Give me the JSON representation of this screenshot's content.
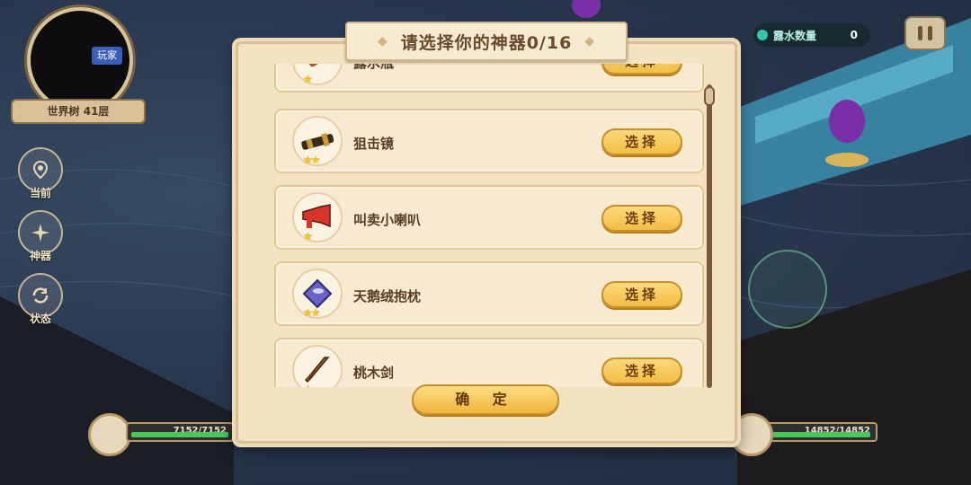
{
  "modal": {
    "title": "请选择你的神器0/16",
    "confirm_label": "确 定",
    "items": [
      {
        "name": "露水瓶",
        "stars": "★",
        "button": "选择",
        "icon": "bottle-icon"
      },
      {
        "name": "狙击镜",
        "stars": "★★",
        "button": "选择",
        "icon": "scope-icon"
      },
      {
        "name": "叫卖小喇叭",
        "stars": "★",
        "button": "选择",
        "icon": "megaphone-icon"
      },
      {
        "name": "天鹅绒抱枕",
        "stars": "★★",
        "button": "选择",
        "icon": "pillow-icon"
      },
      {
        "name": "桃木剑",
        "stars": "★",
        "button": "选择",
        "icon": "wooden-sword-icon"
      }
    ]
  },
  "minimap": {
    "player_label": "玩家",
    "floor": "世界树 41层"
  },
  "side_menu": [
    {
      "label": "当前",
      "icon": "location-pin-icon"
    },
    {
      "label": "神器",
      "icon": "compass-star-icon"
    },
    {
      "label": "状态",
      "icon": "cycle-icon"
    }
  ],
  "dew": {
    "label": "露水数量",
    "value": "0"
  },
  "heroes": [
    {
      "hp": "7152/7152",
      "fill": 1.0
    },
    {
      "hp": "14852/14852",
      "fill": 1.0
    }
  ],
  "colors": {
    "accent": "#f3bd45",
    "panel": "#f3e3c2",
    "hp": "#48c85a"
  }
}
